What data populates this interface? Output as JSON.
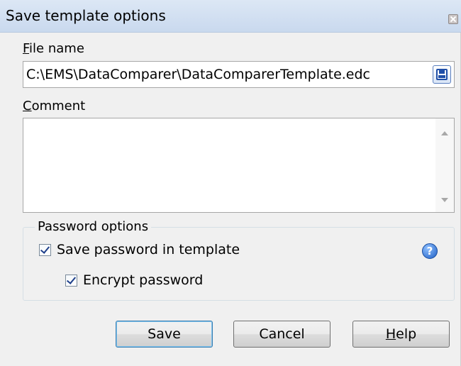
{
  "window": {
    "title": "Save template options"
  },
  "file_name": {
    "label_first": "F",
    "label_rest": "ile name",
    "value": "C:\\EMS\\DataComparer\\DataComparerTemplate.edc"
  },
  "comment": {
    "label_first": "C",
    "label_rest": "omment",
    "value": ""
  },
  "password_options": {
    "legend": "Password options",
    "save_password": {
      "label": "Save password in template",
      "checked": true
    },
    "encrypt_password": {
      "label": "Encrypt password",
      "checked": true
    }
  },
  "buttons": {
    "save": "Save",
    "cancel": "Cancel",
    "help_first": "H",
    "help_rest": "elp"
  },
  "icons": {
    "close": "close-icon",
    "save_disk": "floppy-disk-icon",
    "help": "help-icon"
  },
  "colors": {
    "accent": "#1f5fc4",
    "title_bar": "#c9d9ee"
  }
}
